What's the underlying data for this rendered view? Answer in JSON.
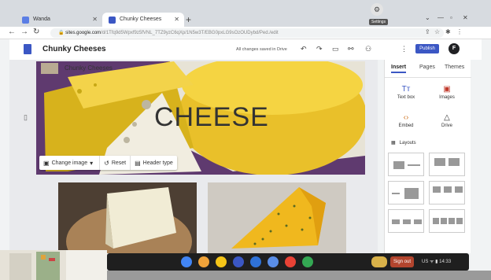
{
  "browser": {
    "tabs": [
      {
        "label": "Wanda",
        "active": false
      },
      {
        "label": "Chunky Cheeses",
        "active": true
      }
    ],
    "url_host": "sites.google.com",
    "url_path": "/d/1Tfq9d5Wpxf9z5fVNL_7TZ9yzC6qXp/1N5w3T/EBG0pxLG9sOzOUDybd/Ped./edit"
  },
  "sites": {
    "title": "Chunky Cheeses",
    "save_status": "All changes saved in Drive",
    "tooltip": "Settings",
    "publish_label": "Publish",
    "avatar_letter": "F",
    "accent": "#3b57c4"
  },
  "banner": {
    "site_name": "Chunky Cheeses",
    "heading": "CHEESE",
    "buttons": {
      "change_image": "Change image",
      "reset": "Reset",
      "header_type": "Header type"
    }
  },
  "panel": {
    "tabs": [
      "Insert",
      "Pages",
      "Themes"
    ],
    "items": [
      {
        "icon": "text-box-icon",
        "label": "Text box"
      },
      {
        "icon": "images-icon",
        "label": "Images"
      },
      {
        "icon": "embed-icon",
        "label": "Embed"
      },
      {
        "icon": "drive-icon",
        "label": "Drive"
      }
    ],
    "layouts_label": "Layouts"
  },
  "shelf": {
    "signout_label": "Sign out",
    "status": "US",
    "time": "14:33"
  }
}
